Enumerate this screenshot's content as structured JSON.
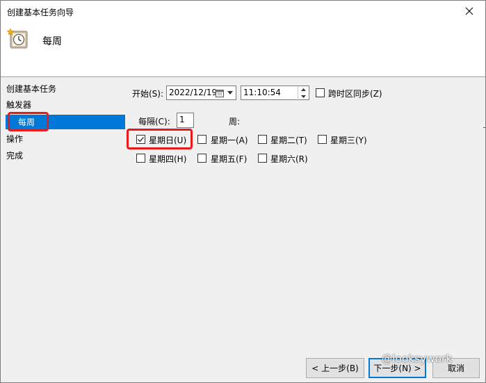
{
  "window": {
    "title": "创建基本任务向导"
  },
  "header": {
    "title": "每周",
    "icon": "clock-task-icon"
  },
  "nav": {
    "items": [
      {
        "label": "创建基本任务"
      },
      {
        "label": "触发器"
      },
      {
        "label": "每周",
        "selected": true
      },
      {
        "label": "操作"
      },
      {
        "label": "完成"
      }
    ]
  },
  "form": {
    "start_label": "开始(S):",
    "start_date": "2022/12/19",
    "start_time": "11:10:54",
    "sync_label": "跨时区同步(Z)",
    "sync_checked": false,
    "recur_label": "每隔(C):",
    "recur_value": "1",
    "recur_unit": "周:",
    "days": [
      {
        "label": "星期日(U)",
        "checked": true
      },
      {
        "label": "星期一(A)",
        "checked": false
      },
      {
        "label": "星期二(T)",
        "checked": false
      },
      {
        "label": "星期三(Y)",
        "checked": false
      },
      {
        "label": "星期四(H)",
        "checked": false
      },
      {
        "label": "星期五(F)",
        "checked": false
      },
      {
        "label": "星期六(R)",
        "checked": false
      }
    ]
  },
  "buttons": {
    "back": "< 上一步(B)",
    "next": "下一步(N) >",
    "cancel": "取消"
  },
  "watermark": "@looksywork",
  "colors": {
    "selection": "#0078d7",
    "highlight": "#e81b1b",
    "content_bg": "#f0f0f0"
  }
}
